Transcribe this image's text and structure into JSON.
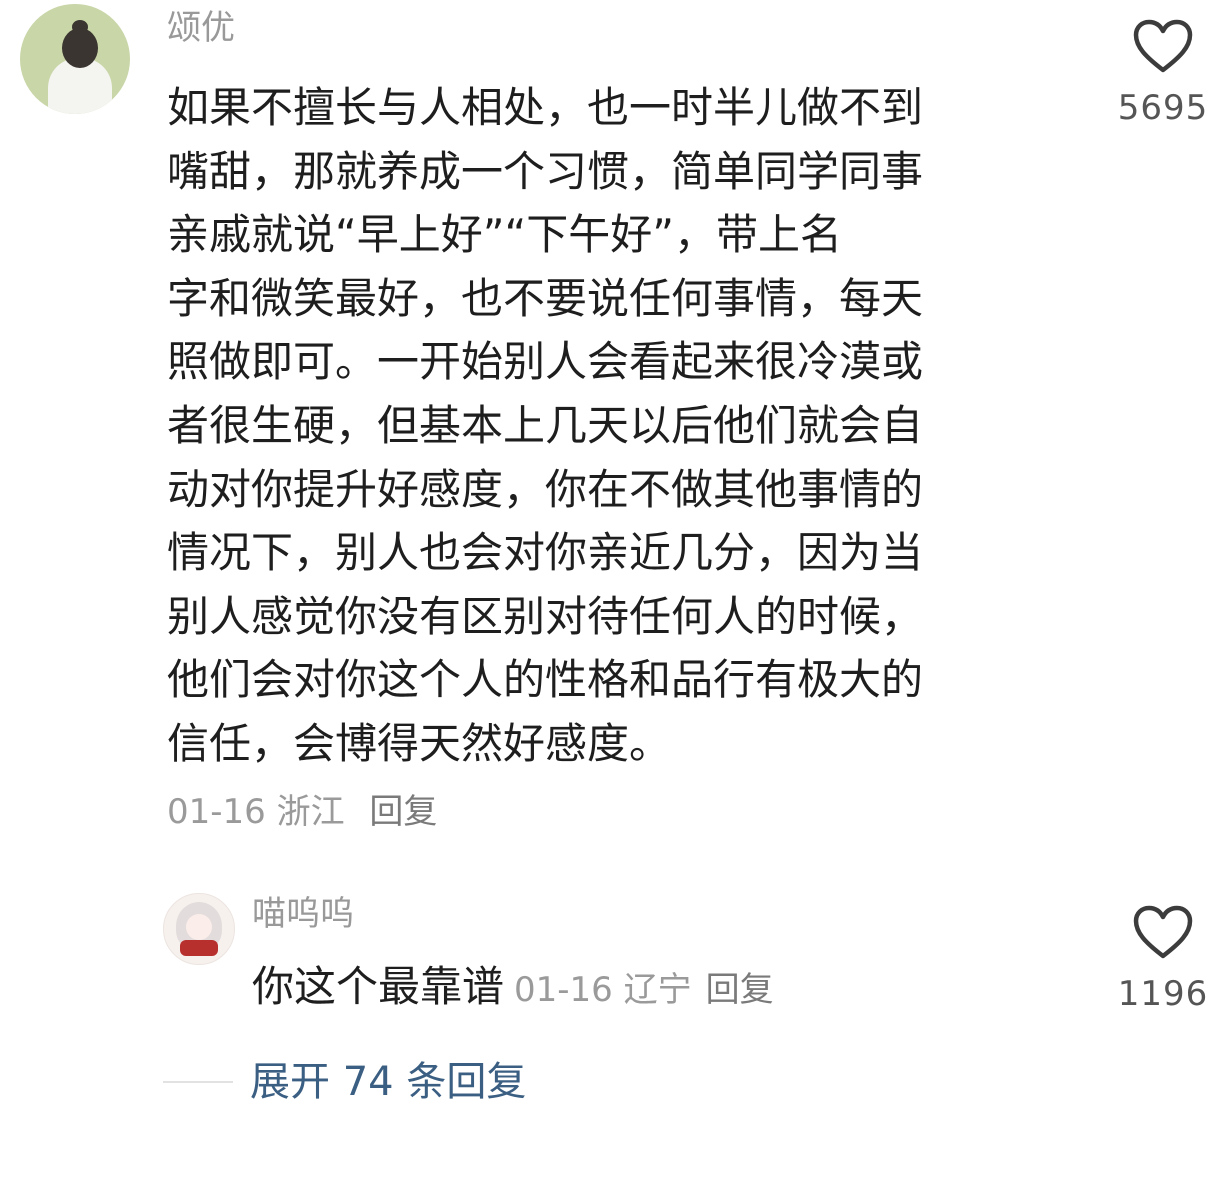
{
  "comment": {
    "username": "颂优",
    "avatar_icon": "user-avatar",
    "text_lines": [
      "如果不擅长与人相处，也一时半儿做不到",
      "嘴甜，那就养成一个习惯，简单同学同事",
      "亲戚就说“早上好”“下午好”，带上名",
      "字和微笑最好，也不要说任何事情，每天",
      "照做即可。一开始别人会看起来很冷漠或",
      "者很生硬，但基本上几天以后他们就会自",
      "动对你提升好感度，你在不做其他事情的",
      "情况下，别人也会对你亲近几分，因为当",
      "别人感觉你没有区别对待任何人的时候，",
      "他们会对你这个人的性格和品行有极大的",
      "信任，会博得天然好感度。"
    ],
    "date": "01-16",
    "location": "浙江",
    "reply_label": "回复",
    "likes": "5695",
    "like_icon": "heart-outline-icon"
  },
  "reply": {
    "username": "喵呜呜",
    "avatar_icon": "anime-girl-avatar",
    "text": "你这个最靠谱",
    "date": "01-16",
    "location": "辽宁",
    "reply_label": "回复",
    "likes": "1196",
    "like_icon": "heart-outline-icon"
  },
  "expand": {
    "label": "展开 74 条回复"
  },
  "colors": {
    "body_text": "#1e1e1e",
    "meta_text": "#9a9a9a",
    "expand_link": "#3b5f82",
    "heart_stroke": "#3c3c3c"
  }
}
